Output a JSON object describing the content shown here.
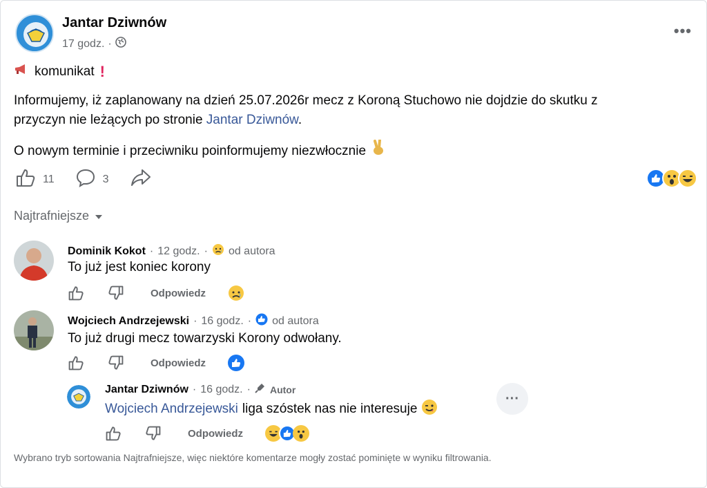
{
  "post": {
    "page_name": "Jantar Dziwnów",
    "time": "17 godz.",
    "separator": "·",
    "heading": "komunikat",
    "body_line1": "Informujemy, iż zaplanowany na dzień 25.07.2026r mecz z Koroną Stuchowo nie dojdzie do skutku z",
    "body_line2_prefix": "przyczyn nie leżących po stronie",
    "body_line2_link": "Jantar Dziwnów",
    "body_line2_suffix": ".",
    "body_line3": "O nowym terminie i przeciwniku poinformujemy niezwłocznie",
    "like_count": "11",
    "comment_count": "3"
  },
  "sort": {
    "label": "Najtrafniejsze"
  },
  "comments": [
    {
      "name": "Dominik Kokot",
      "time": "12 godz.",
      "badge": "od autora",
      "text": "To już jest koniec korony",
      "reply_label": "Odpowiedz"
    },
    {
      "name": "Wojciech Andrzejewski",
      "time": "16 godz.",
      "badge": "od autora",
      "text": "To już drugi mecz towarzyski Korony odwołany.",
      "reply_label": "Odpowiedz"
    }
  ],
  "reply": {
    "name": "Jantar Dziwnów",
    "time": "16 godz.",
    "author_label": "Autor",
    "mention": "Wojciech Andrzejewski",
    "text": "liga szóstek nas nie interesuje",
    "reply_label": "Odpowiedz"
  },
  "footer": {
    "text": "Wybrano tryb sortowania Najtrafniejsze, więc niektóre komentarze mogły zostać pominięte w wyniku filtrowania."
  },
  "colors": {
    "link": "#385898",
    "like_blue": "#1877f2",
    "muted": "#65686c"
  }
}
